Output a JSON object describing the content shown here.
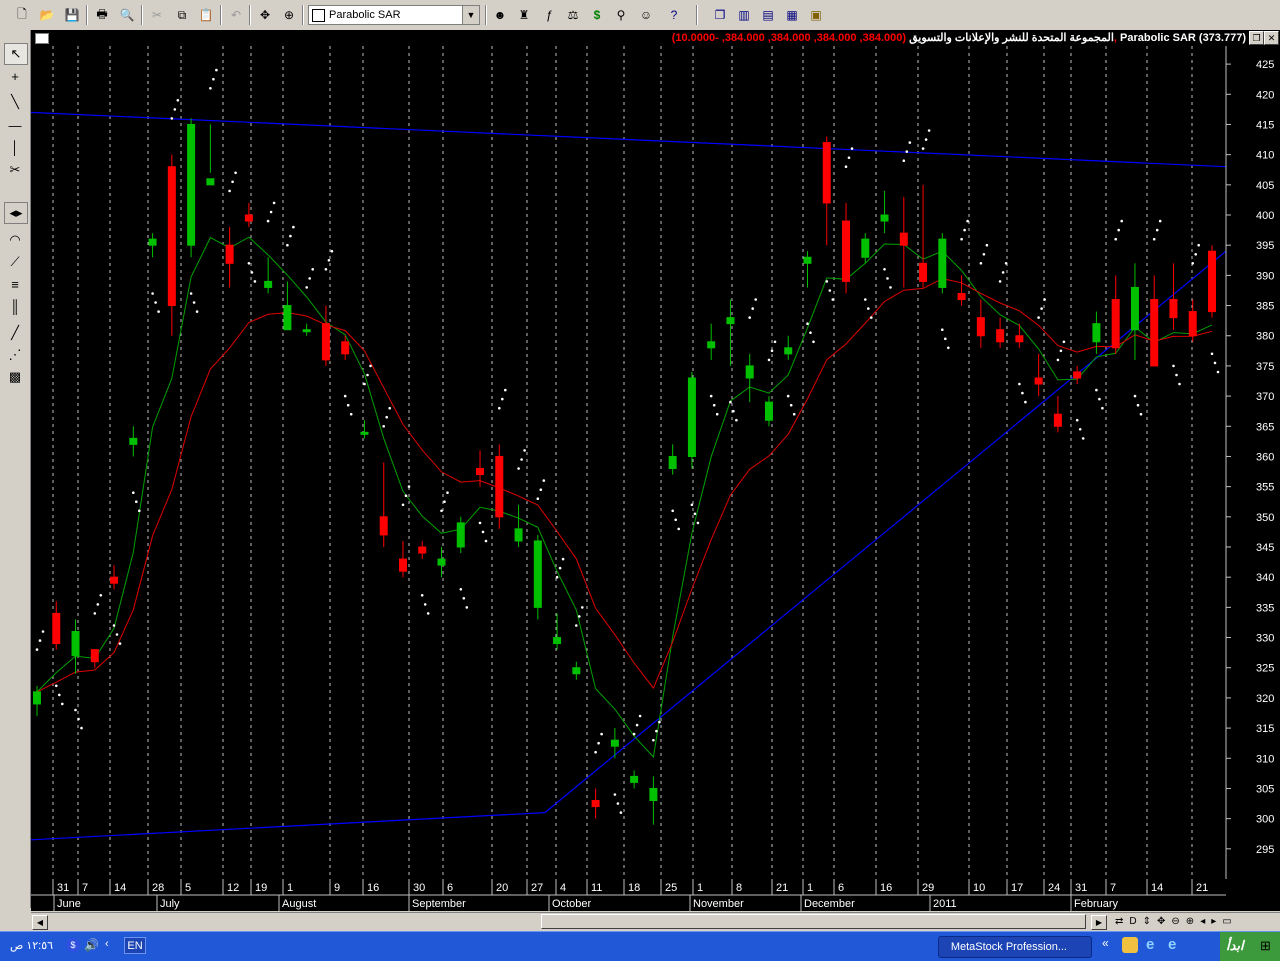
{
  "toolbar": {
    "indicator_select_value": "Parabolic SAR"
  },
  "chart_window": {
    "company_name": "المجموعة المتحدة للنشر والإعلانات والتسويق",
    "ohlc": "(384.000, 384.000, 384.000, 384.000, -10.0000),",
    "indicator_label": "Parabolic SAR (373.777)"
  },
  "taskbar": {
    "clock": "١٢:٥٦ ص",
    "language": "EN",
    "task_item": "MetaStock Profession...",
    "start_label": "ابدأ"
  },
  "colors": {
    "background": "#000000",
    "up_candle": "#00c000",
    "down_candle": "#ff0000",
    "ma_fast": "#00a000",
    "ma_slow": "#e00000",
    "sar_dots": "#ffffff",
    "trendlines": "#0000ff",
    "grid": "#c0c0c0"
  },
  "chart_data": {
    "type": "candlestick",
    "y_axis": {
      "min": 290,
      "max": 428,
      "ticks": [
        295,
        300,
        305,
        310,
        315,
        320,
        325,
        330,
        335,
        340,
        345,
        350,
        355,
        360,
        365,
        370,
        375,
        380,
        385,
        390,
        395,
        400,
        405,
        410,
        415,
        420,
        425
      ],
      "position": "right"
    },
    "x_tick_labels": [
      "31",
      "7",
      "14",
      "28",
      "5",
      "12",
      "19",
      "1",
      "9",
      "16",
      "30",
      "6",
      "20",
      "27",
      "4",
      "11",
      "18",
      "25",
      "1",
      "8",
      "21",
      "1",
      "6",
      "16",
      "29",
      "10",
      "17",
      "24",
      "31",
      "7",
      "14",
      "21"
    ],
    "month_labels": [
      "June",
      "July",
      "August",
      "September",
      "October",
      "November",
      "December",
      "2011",
      "February"
    ],
    "grid": "vertical dashed",
    "candles": [
      [
        319,
        322,
        317,
        321
      ],
      [
        334,
        336,
        328,
        329
      ],
      [
        327,
        333,
        324,
        331
      ],
      [
        328,
        328,
        325,
        326
      ],
      [
        340,
        342,
        338,
        339
      ],
      [
        362,
        365,
        360,
        363
      ],
      [
        395,
        397,
        393,
        396
      ],
      [
        408,
        410,
        380,
        385
      ],
      [
        395,
        416,
        393,
        415
      ],
      [
        405,
        415,
        407,
        406
      ],
      [
        395,
        398,
        388,
        392
      ],
      [
        400,
        402,
        398,
        399
      ],
      [
        388,
        393,
        387,
        389
      ],
      [
        381,
        389,
        381,
        385
      ],
      [
        381,
        382,
        380,
        381
      ],
      [
        382,
        385,
        375,
        376
      ],
      [
        379,
        380,
        376,
        377
      ],
      [
        364,
        366,
        363,
        364
      ],
      [
        350,
        359,
        345,
        347
      ],
      [
        343,
        346,
        340,
        341
      ],
      [
        345,
        346,
        343,
        344
      ],
      [
        342,
        345,
        340,
        343
      ],
      [
        345,
        350,
        344,
        349
      ],
      [
        358,
        361,
        355,
        357
      ],
      [
        360,
        362,
        348,
        350
      ],
      [
        346,
        352,
        345,
        348
      ],
      [
        335,
        347,
        333,
        346
      ],
      [
        329,
        334,
        328,
        330
      ],
      [
        324,
        326,
        323,
        325
      ],
      [
        303,
        305,
        300,
        302
      ],
      [
        312,
        315,
        310,
        313
      ],
      [
        306,
        308,
        305,
        307
      ],
      [
        303,
        307,
        299,
        305
      ],
      [
        358,
        362,
        357,
        360
      ],
      [
        360,
        374,
        358,
        373
      ],
      [
        378,
        382,
        376,
        379
      ],
      [
        382,
        386,
        375,
        383
      ],
      [
        373,
        377,
        369,
        375
      ],
      [
        366,
        370,
        365,
        369
      ],
      [
        377,
        380,
        376,
        378
      ],
      [
        392,
        394,
        388,
        393
      ],
      [
        412,
        413,
        395,
        402
      ],
      [
        399,
        402,
        387,
        389
      ],
      [
        393,
        397,
        392,
        396
      ],
      [
        399,
        404,
        397,
        400
      ],
      [
        397,
        403,
        388,
        395
      ],
      [
        392,
        405,
        388,
        389
      ],
      [
        388,
        397,
        387,
        396
      ],
      [
        387,
        390,
        385,
        386
      ],
      [
        383,
        386,
        378,
        380
      ],
      [
        381,
        383,
        378,
        379
      ],
      [
        380,
        382,
        378,
        379
      ],
      [
        373,
        377,
        370,
        372
      ],
      [
        367,
        370,
        364,
        365
      ],
      [
        374,
        375,
        372,
        373
      ],
      [
        379,
        384,
        377,
        382
      ],
      [
        386,
        390,
        377,
        378
      ],
      [
        381,
        392,
        376,
        388
      ],
      [
        386,
        390,
        377,
        375
      ],
      [
        386,
        392,
        381,
        383
      ],
      [
        384,
        386,
        379,
        380
      ],
      [
        394,
        395,
        383,
        384
      ]
    ],
    "trendlines": [
      {
        "name": "upper resistance",
        "points": [
          [
            0.0,
            417.0
          ],
          [
            1.0,
            408.0
          ]
        ]
      },
      {
        "name": "lower support",
        "points": [
          [
            0.0,
            296.5
          ],
          [
            0.43,
            301.0
          ],
          [
            1.0,
            394.0
          ]
        ]
      }
    ],
    "indicators": [
      "Parabolic SAR",
      "Moving Average (fast)",
      "Moving Average (slow)"
    ]
  }
}
